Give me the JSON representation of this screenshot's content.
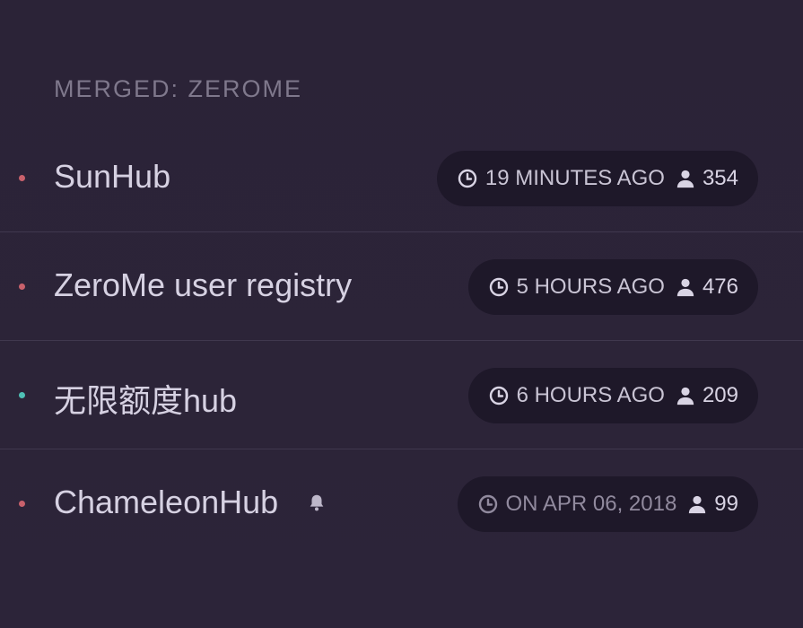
{
  "section": {
    "title": "MERGED: ZEROME"
  },
  "hubs": [
    {
      "name": "SunHub",
      "time": "19 MINUTES AGO",
      "users": "354",
      "dot_color": "#c9616c",
      "bell": false,
      "dim": false
    },
    {
      "name": "ZeroMe user registry",
      "time": "5 HOURS AGO",
      "users": "476",
      "dot_color": "#c9616c",
      "bell": false,
      "dim": false
    },
    {
      "name": "无限额度hub",
      "time": "6 HOURS AGO",
      "users": "209",
      "dot_color": "#4fc1b6",
      "bell": false,
      "dim": false
    },
    {
      "name": "ChameleonHub",
      "time": "ON APR 06, 2018",
      "users": "99",
      "dot_color": "#c9616c",
      "bell": true,
      "dim": true
    }
  ],
  "icons": {
    "time": "clock-icon",
    "users": "user-icon",
    "notify": "bell-icon"
  },
  "colors": {
    "background": "#2c2338",
    "pill": "#1e1829",
    "title": "#7f788c"
  }
}
